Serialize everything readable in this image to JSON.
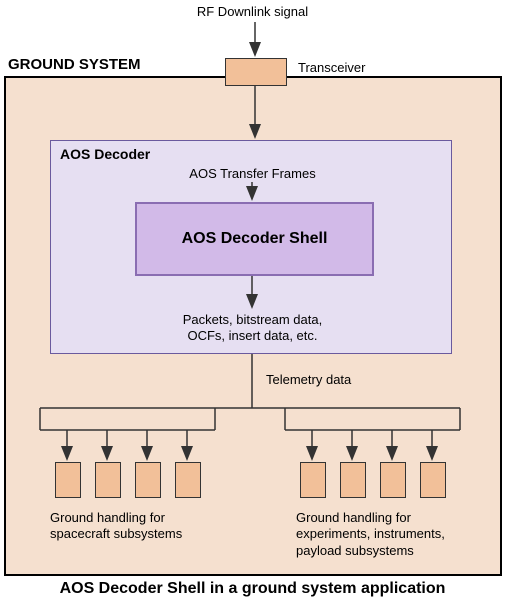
{
  "rf_label": "RF Downlink signal",
  "transceiver_label": "Transceiver",
  "ground_system_title": "GROUND SYSTEM",
  "aos_decoder_title": "AOS Decoder",
  "aos_tf_label": "AOS Transfer Frames",
  "aos_shell_label": "AOS Decoder Shell",
  "packets_label_line1": "Packets, bitstream data,",
  "packets_label_line2": "OCFs,  insert data, etc.",
  "telemetry_label": "Telemetry data",
  "gh_left_line1": "Ground handling for",
  "gh_left_line2": "spacecraft subsystems",
  "gh_right_line1": "Ground handling for",
  "gh_right_line2": "experiments, instruments,",
  "gh_right_line3": "payload subsystems",
  "caption": "AOS Decoder Shell in a ground system application"
}
